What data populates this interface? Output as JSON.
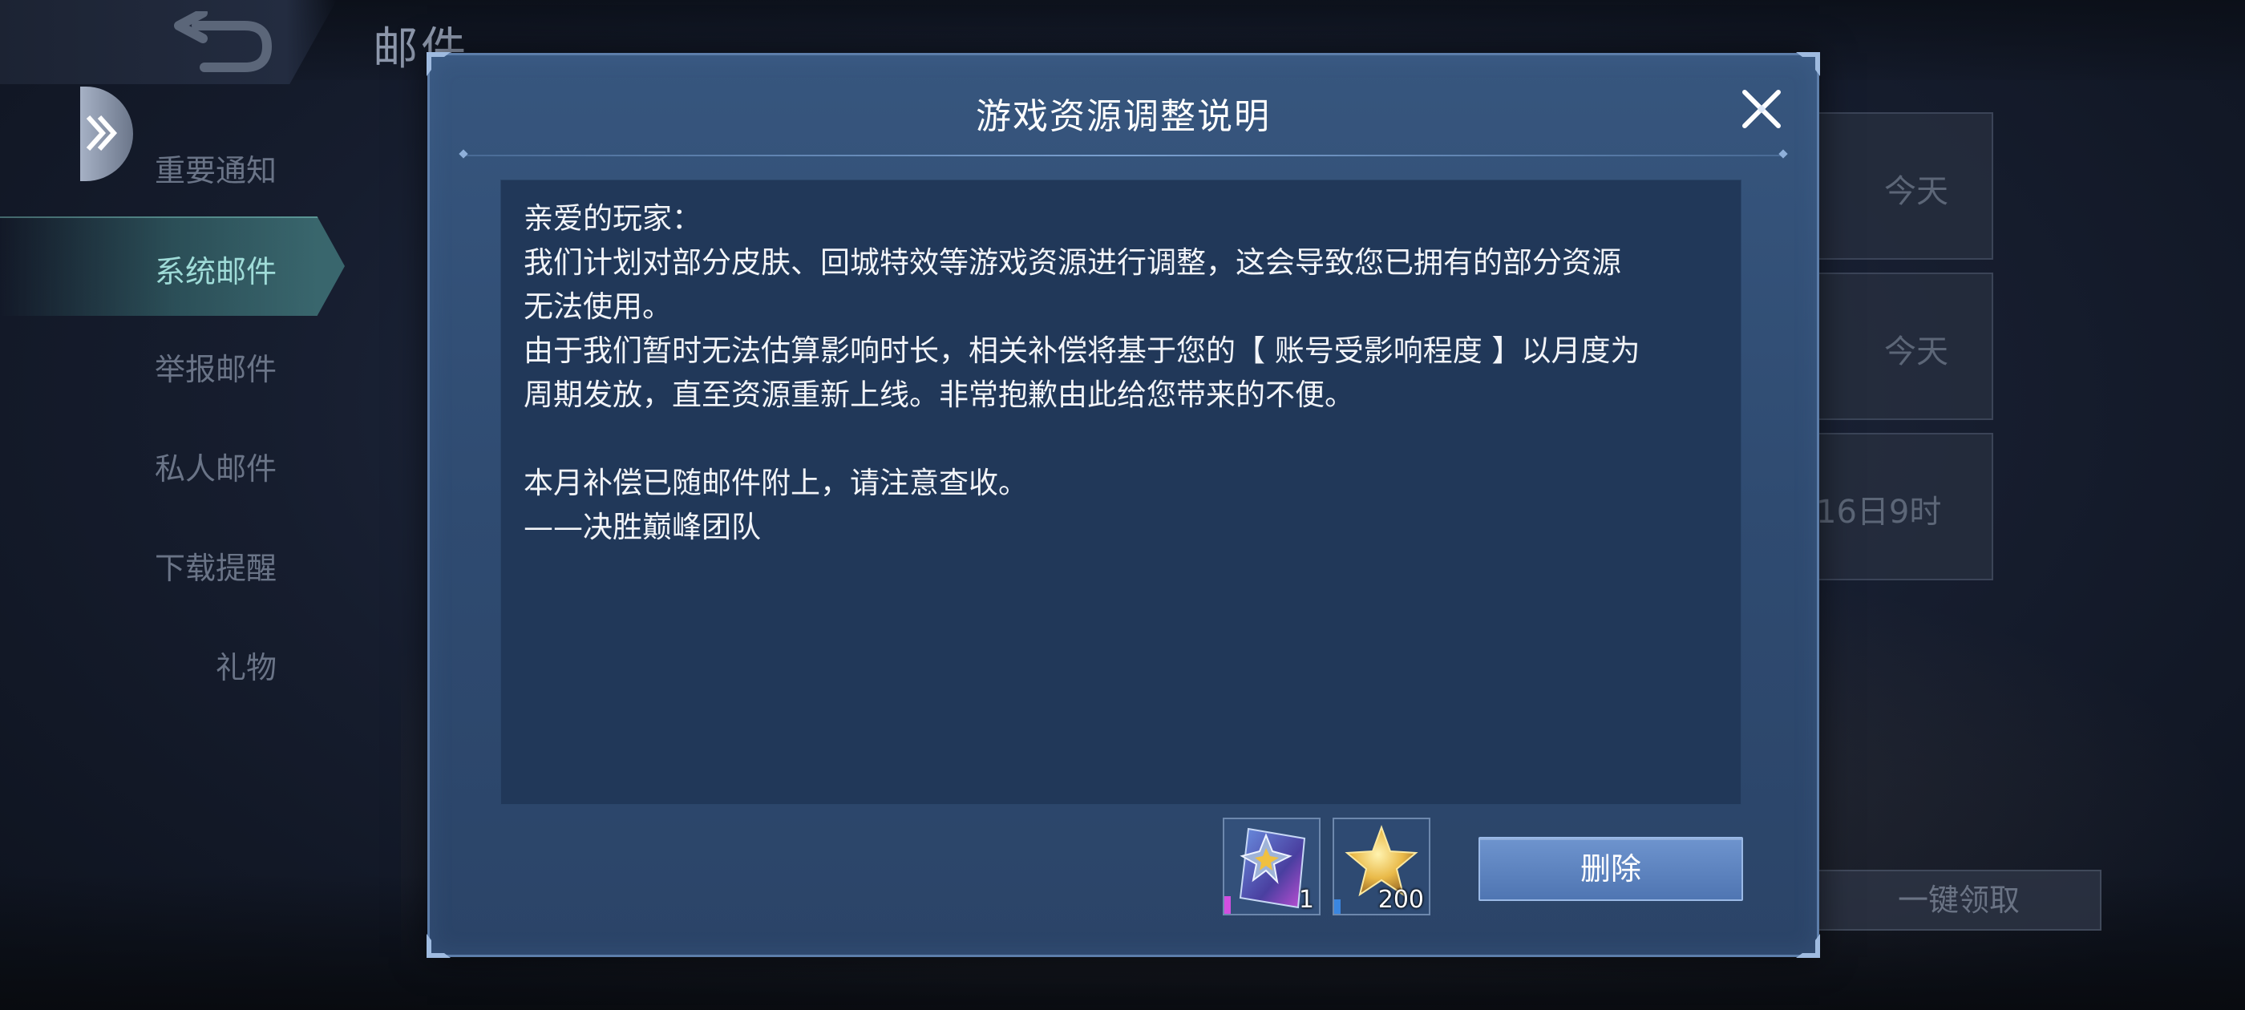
{
  "header": {
    "title": "邮件"
  },
  "sidebar": {
    "items": [
      {
        "label": "重要通知"
      },
      {
        "label": "系统邮件"
      },
      {
        "label": "举报邮件"
      },
      {
        "label": "私人邮件"
      },
      {
        "label": "下载提醒"
      },
      {
        "label": "礼物"
      }
    ],
    "active_index": 1
  },
  "background_list": {
    "items": [
      {
        "time": "今天"
      },
      {
        "time": "今天"
      },
      {
        "time": "16日9时"
      }
    ],
    "claim_all_label": "一键领取"
  },
  "modal": {
    "title": "游戏资源调整说明",
    "body": [
      "亲爱的玩家：",
      "我们计划对部分皮肤、回城特效等游戏资源进行调整，这会导致您已拥有的部分资源",
      "无法使用。",
      "由于我们暂时无法估算影响时长，相关补偿将基于您的【 账号受影响程度 】以月度为",
      "周期发放，直至资源重新上线。非常抱歉由此给您带来的不便。",
      "",
      "本月补偿已随邮件附上，请注意查收。",
      "——决胜巅峰团队"
    ],
    "rewards": [
      {
        "icon": "card-item-icon",
        "count": "1"
      },
      {
        "icon": "gold-star-icon",
        "count": "200"
      }
    ],
    "delete_label": "删除"
  },
  "colors": {
    "modal_bg": "#2f4b71",
    "content_bg": "#213859",
    "button": "#5a80bd"
  }
}
